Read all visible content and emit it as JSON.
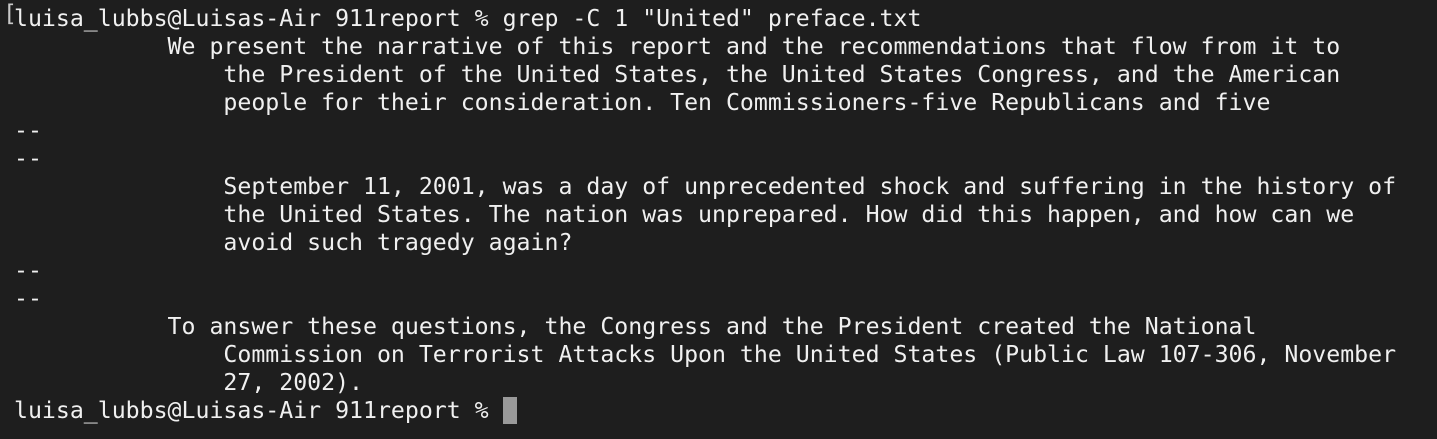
{
  "terminal": {
    "prompt_bracket": "[",
    "lines": [
      "luisa_lubbs@Luisas-Air 911report % grep -C 1 \"United\" preface.txt",
      "           We present the narrative of this report and the recommendations that flow from it to",
      "               the President of the United States, the United States Congress, and the American",
      "               people for their consideration. Ten Commissioners-five Republicans and five",
      "--",
      "--",
      "               September 11, 2001, was a day of unprecedented shock and suffering in the history of",
      "               the United States. The nation was unprepared. How did this happen, and how can we",
      "               avoid such tragedy again?",
      "--",
      "--",
      "           To answer these questions, the Congress and the President created the National",
      "               Commission on Terrorist Attacks Upon the United States (Public Law 107-306, November",
      "               27, 2002).",
      "luisa_lubbs@Luisas-Air 911report % "
    ]
  }
}
